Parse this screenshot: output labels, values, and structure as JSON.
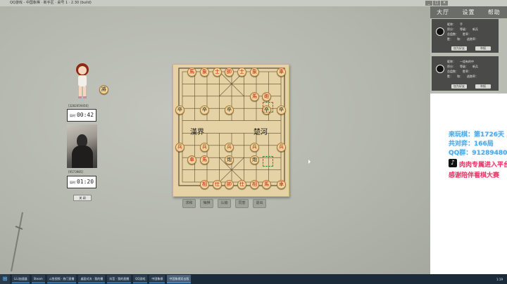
{
  "window": {
    "title": "QQ游戏 - 中国象棋 · 新手区 · 桌号 1 · 2.30 (build)",
    "controls": [
      "_",
      "□",
      "×"
    ]
  },
  "menu": {
    "items": [
      "大厅",
      "设置",
      "帮助"
    ]
  },
  "top_panel": {
    "name_label": "昵称：",
    "name_value": "手",
    "stats_left": [
      "积分：",
      "总盘数：",
      "胜：",
      "和："
    ],
    "stats_right": [
      "等级：",
      "新兵",
      "胜率：",
      "逃跑率："
    ],
    "buttons": [
      "加为好友",
      "举报"
    ]
  },
  "bottom_panel": {
    "name_label": "昵称：",
    "name_value": "一组有的中",
    "stats_left": [
      "积分：",
      "总盘数：",
      "胜：",
      "和："
    ],
    "stats_right": [
      "等级：",
      "新兵",
      "胜率：",
      "逃跑率："
    ],
    "buttons": [
      "加为好友",
      "举报"
    ]
  },
  "overlay": {
    "line1": "来玩棋：第1726天",
    "line2": "共对弈：166局",
    "line3": "QQ群：912894801",
    "line4": "肉肉专属进入平台",
    "line5": "感谢陪伴看棋大赛"
  },
  "board": {
    "river_left": "漢界",
    "river_right": "楚河",
    "pieces": [
      {
        "t": "馬",
        "c": "red"
      },
      {
        "t": "象",
        "c": "red"
      },
      {
        "t": "士",
        "c": "red"
      },
      {
        "t": "帥",
        "c": "red"
      },
      {
        "t": "士",
        "c": "red"
      },
      {
        "t": "象",
        "c": "red"
      },
      {
        "t": "車",
        "c": "red"
      },
      {
        "t": "馬",
        "c": "red"
      },
      {
        "t": "砲",
        "c": "red"
      },
      {
        "t": "卒",
        "c": "blk"
      },
      {
        "t": "卒",
        "c": "blk"
      },
      {
        "t": "卒",
        "c": "blk"
      },
      {
        "t": "卒",
        "c": "blk"
      },
      {
        "t": "卒",
        "c": "blk"
      },
      {
        "t": "兵",
        "c": "red"
      },
      {
        "t": "兵",
        "c": "red"
      },
      {
        "t": "兵",
        "c": "red"
      },
      {
        "t": "兵",
        "c": "red"
      },
      {
        "t": "兵",
        "c": "red"
      },
      {
        "t": "車",
        "c": "red"
      },
      {
        "t": "馬",
        "c": "red"
      },
      {
        "t": "炮",
        "c": "blk"
      },
      {
        "t": "炮",
        "c": "blk"
      },
      {
        "t": "相",
        "c": "red"
      },
      {
        "t": "仕",
        "c": "red"
      },
      {
        "t": "帥",
        "c": "red"
      },
      {
        "t": "仕",
        "c": "red"
      },
      {
        "t": "相",
        "c": "red"
      },
      {
        "t": "馬",
        "c": "red"
      },
      {
        "t": "車",
        "c": "red"
      }
    ]
  },
  "controls": [
    "求和",
    "悔棋",
    "认输",
    "同意",
    "退出"
  ],
  "left": {
    "side_piece": "將",
    "upper_id": "[3282059456]",
    "upper_clock_label": "局时",
    "upper_clock": "00:42",
    "lower_id": "[9573985]",
    "lower_clock_label": "局时",
    "lower_clock": "01:20",
    "small_button": "关 闭"
  },
  "taskbar": {
    "start": "⊞",
    "items": [
      "LiLi加速器",
      "Steam",
      "斗鱼视频 · 热门直播",
      "桌面对决 · 我的播",
      "抖音 · 我的直播",
      "QQ游戏",
      "中国象棋",
      "中国象棋双击版"
    ],
    "clock": "1:19"
  }
}
